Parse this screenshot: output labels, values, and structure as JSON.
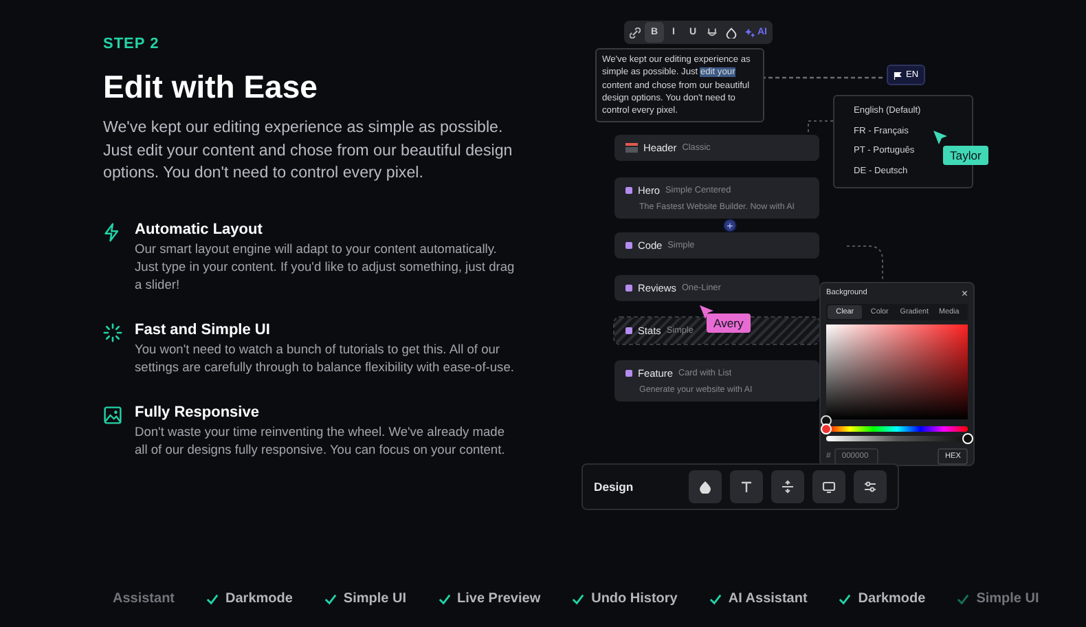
{
  "step": "STEP 2",
  "title": "Edit with Ease",
  "intro": "We've kept our editing experience as simple as possible. Just edit your content and chose from our beautiful design options. You don't need to control every pixel.",
  "features": [
    {
      "title": "Automatic Layout",
      "description": "Our smart layout engine will adapt to your content automatically. Just type in your content. If you'd like to adjust something, just drag a slider!"
    },
    {
      "title": "Fast and Simple UI",
      "description": "You won't need to watch a bunch of tutorials to get this. All of our settings are carefully through to balance flexibility with ease-of-use."
    },
    {
      "title": "Fully Responsive",
      "description": "Don't waste your time reinventing the wheel. We've already made all of our designs fully responsive. You can focus on your content."
    }
  ],
  "editor": {
    "toolbar": [
      {
        "kind": "icon",
        "selected": false
      },
      {
        "kind": "text",
        "label": "B",
        "selected": true
      },
      {
        "kind": "text",
        "label": "I",
        "selected": false
      },
      {
        "kind": "text",
        "label": "U",
        "selected": false
      },
      {
        "kind": "icon",
        "selected": false
      },
      {
        "kind": "icon",
        "selected": false
      },
      {
        "kind": "ai",
        "label": "AI",
        "selected": false
      }
    ],
    "text": [
      {
        "text": "We've kept our editing experience as simple as possible. Just ",
        "highlighted": false
      },
      {
        "text": "edit your",
        "highlighted": true
      },
      {
        "text": " content and chose from our beautiful design options. You don't need to control every pixel.",
        "highlighted": false
      }
    ]
  },
  "language": {
    "button": "EN",
    "options": [
      {
        "label": "English (Default)"
      },
      {
        "label": "FR - Français"
      },
      {
        "label": "PT - Português"
      },
      {
        "label": "DE - Deutsch"
      }
    ]
  },
  "sections": [
    {
      "kind": "header",
      "name": "Header",
      "variant": "Classic",
      "dragging": false
    },
    {
      "kind": "section",
      "name": "Hero",
      "variant": "Simple Centered",
      "subtitle": "The Fastest Website Builder. Now with AI",
      "dragging": false
    },
    {
      "kind": "add",
      "label": "+"
    },
    {
      "kind": "section",
      "name": "Code",
      "variant": "Simple",
      "dragging": false
    },
    {
      "kind": "section",
      "name": "Reviews",
      "variant": "One-Liner",
      "dragging": false
    },
    {
      "kind": "section",
      "name": "Stats",
      "variant": "Simple",
      "dragging": true
    },
    {
      "kind": "section",
      "name": "Feature",
      "variant": "Card with List",
      "subtitle": "Generate your website with AI",
      "dragging": false
    }
  ],
  "cursors": [
    {
      "name": "Taylor",
      "color": "#40d9b6"
    },
    {
      "name": "Avery",
      "color": "#e86bd3"
    }
  ],
  "color_picker": {
    "title": "Background",
    "close": "×",
    "tabs": [
      {
        "label": "Clear",
        "selected": true
      },
      {
        "label": "Color",
        "selected": false
      },
      {
        "label": "Gradient",
        "selected": false
      },
      {
        "label": "Media",
        "selected": false
      }
    ],
    "hue": {
      "level": 0
    },
    "alpha": {
      "level": 1
    },
    "hash": "#",
    "hex_value": "000000",
    "format_button": "HEX"
  },
  "design_bar": {
    "label": "Design"
  },
  "strip": [
    {
      "label": "Assistant",
      "check": false,
      "faded": true
    },
    {
      "label": "Darkmode",
      "check": true,
      "faded": false
    },
    {
      "label": "Simple UI",
      "check": true,
      "faded": false
    },
    {
      "label": "Live Preview",
      "check": true,
      "faded": false
    },
    {
      "label": "Undo History",
      "check": true,
      "faded": false
    },
    {
      "label": "AI Assistant",
      "check": true,
      "faded": false
    },
    {
      "label": "Darkmode",
      "check": true,
      "faded": false
    },
    {
      "label": "Simple UI",
      "check": true,
      "faded": true
    }
  ]
}
